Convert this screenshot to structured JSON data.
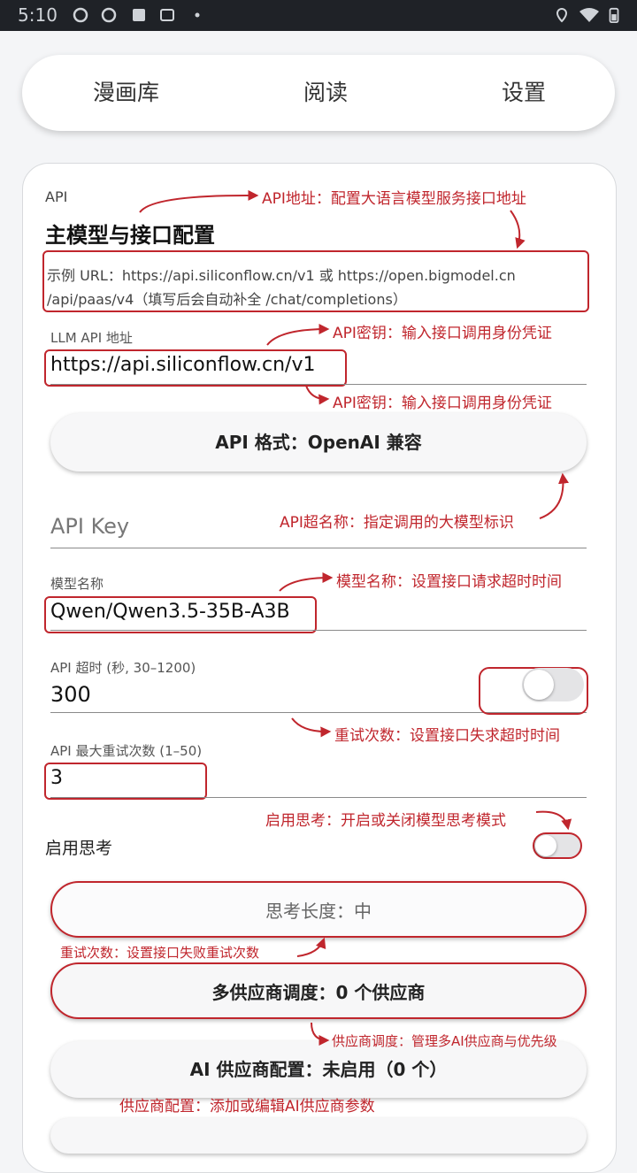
{
  "status_bar": {
    "time": "5:10"
  },
  "tabs": [
    {
      "label": "漫画库"
    },
    {
      "label": "阅读"
    },
    {
      "label": "设置"
    }
  ],
  "settings": {
    "section_label": "API",
    "section_title": "主模型与接口配置",
    "example_line1": "示例 URL：https://api.siliconflow.cn/v1 或 https://open.bigmodel.cn",
    "example_line2": "/api/paas/v4（填写后会自动补全 /chat/completions）",
    "llm_url_label": "LLM API 地址",
    "llm_url_value": "https://api.siliconflow.cn/v1",
    "api_format_button": "API 格式：OpenAI 兼容",
    "api_key_placeholder": "API Key",
    "model_name_label": "模型名称",
    "model_name_value": "Qwen/Qwen3.5-35B-A3B",
    "timeout_label": "API 超时 (秒, 30–1200)",
    "timeout_value": "300",
    "timeout_toggle_on": false,
    "retries_label": "API 最大重试次数 (1–50)",
    "retries_value": "3",
    "thinking_label": "启用思考",
    "thinking_toggle_on": false,
    "thinking_length_button": "思考长度：中",
    "multi_provider_button": "多供应商调度：0 个供应商",
    "provider_config_button": "AI 供应商配置：未启用（0 个）"
  },
  "annotations": {
    "api_address": "API地址：配置大语言模型服务接口地址",
    "api_key_1": "API密钥：输入接口调用身份凭证",
    "api_key_2": "API密钥：输入接口调用身份凭证",
    "api_model_name": "API超名称：指定调用的大模型标识",
    "model_name": "模型名称：设置接口请求超时时间",
    "retry_count_1": "重试次数：设置接口失求超时时间",
    "thinking": "启用思考：开启或关闭模型思考模式",
    "retry_count_2": "重试次数：设置接口失败重试次数",
    "provider_scheduling": "供应商调度：管理多AI供应商与优先级",
    "provider_config": "供应商配置：添加或编辑AI供应商参数"
  },
  "colors": {
    "annotation_red": "#c0262d",
    "background": "#f4f5f7",
    "status_bar": "#1f2227"
  }
}
